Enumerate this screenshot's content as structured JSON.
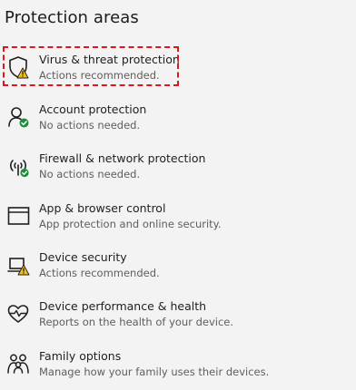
{
  "section": {
    "heading": "Protection areas"
  },
  "items": [
    {
      "title": "Virus & threat protection",
      "subtitle": "Actions recommended.",
      "icon": "virus-shield-warning-icon",
      "highlighted": true
    },
    {
      "title": "Account protection",
      "subtitle": "No actions needed.",
      "icon": "account-protection-icon"
    },
    {
      "title": "Firewall & network protection",
      "subtitle": "No actions needed.",
      "icon": "firewall-network-icon"
    },
    {
      "title": "App & browser control",
      "subtitle": "App protection and online security.",
      "icon": "app-browser-control-icon"
    },
    {
      "title": "Device security",
      "subtitle": "Actions recommended.",
      "icon": "device-security-warning-icon"
    },
    {
      "title": "Device performance & health",
      "subtitle": "Reports on the health of your device.",
      "icon": "device-health-heart-icon"
    },
    {
      "title": "Family options",
      "subtitle": "Manage how your family uses their devices.",
      "icon": "family-options-icon"
    }
  ],
  "colors": {
    "highlight_border": "#e0161f",
    "warning_badge": "#f2c11b",
    "ok_badge": "#1a8f3a"
  }
}
